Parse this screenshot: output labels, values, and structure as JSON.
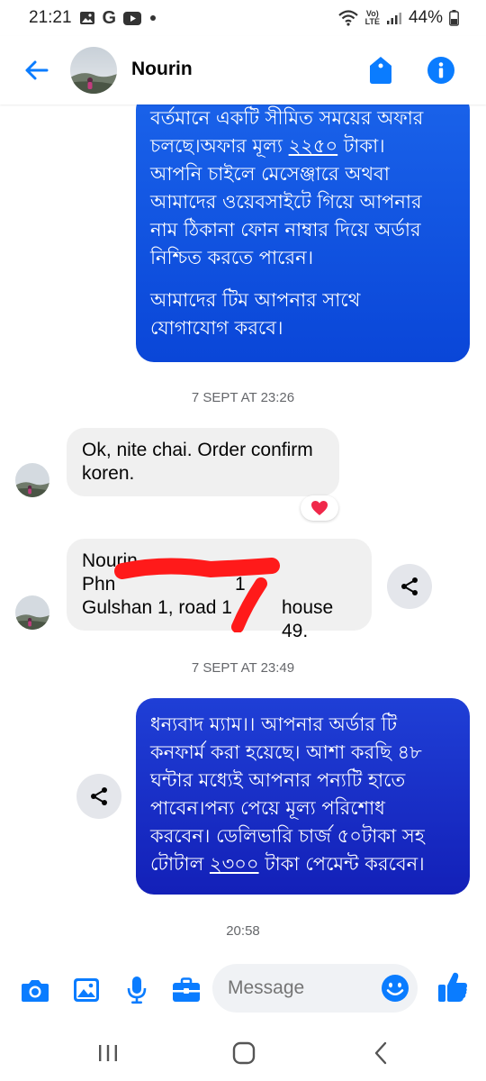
{
  "status_bar": {
    "time": "21:21",
    "battery": "44%",
    "net_label_top": "Vo)",
    "net_label_bottom": "LTE"
  },
  "header": {
    "contact_name": "Nourin",
    "back_icon": "back-arrow-icon",
    "tag_icon": "tag-icon",
    "info_icon": "info-icon"
  },
  "messages": {
    "out1": {
      "lines": [
        "বর্তমানে একটি সীমিত সময়ের অফার",
        "চলছে।অফার মূল্য ",
        "২২৫০",
        " টাকা।",
        "আপনি চাইলে মেসেঞ্জারে  অথবা",
        "আমাদের ওয়েবসাইটে গিয়ে আপনার",
        "নাম ঠিকানা ফোন নাম্বার দিয়ে অর্ডার",
        "নিশ্চিত করতে পারেন।",
        "আমাদের টিম আপনার সাথে",
        "যোগাযোগ করবে।"
      ]
    },
    "ts1": "7 SEPT AT 23:26",
    "in1": {
      "line1": "Ok, nite chai. Order confirm",
      "line2": "koren.",
      "reaction": "heart"
    },
    "in2": {
      "line1": "Nourin",
      "line2_prefix": "Phn",
      "line2_suffix": "1",
      "line3_prefix": "Gulshan 1, road 1",
      "line3_suffix": "house 49."
    },
    "ts2": "7 SEPT AT 23:49",
    "out2": {
      "lines": [
        "ধন্যবাদ ম্যাম।। আপনার অর্ডার টি",
        "কনফার্ম করা হয়েছে। আশা করছি ৪৮",
        "ঘন্টার মধ্যেই আপনার পন্যটি হাতে",
        "পাবেন।পন্য পেয়ে মূল্য পরিশোধ",
        "করবেন। ডেলিভারি চার্জ ৫০টাকা সহ",
        "টোটাল ",
        "২৩০০",
        " টাকা পেমেন্ট করবেন।"
      ]
    },
    "ts3": "20:58"
  },
  "composer": {
    "placeholder": "Message",
    "icons": [
      "camera-icon",
      "gallery-icon",
      "microphone-icon",
      "briefcase-icon",
      "emoji-icon",
      "thumbs-up-icon"
    ]
  },
  "navbar": {
    "icons": [
      "recent-apps-icon",
      "home-icon",
      "back-icon"
    ]
  },
  "colors": {
    "accent": "#0a7cff",
    "bubble_out": "#1558e8",
    "bubble_out_dark": "#1a2fc8",
    "bubble_in": "#f0f0f0",
    "redaction": "#ff1a1a"
  }
}
